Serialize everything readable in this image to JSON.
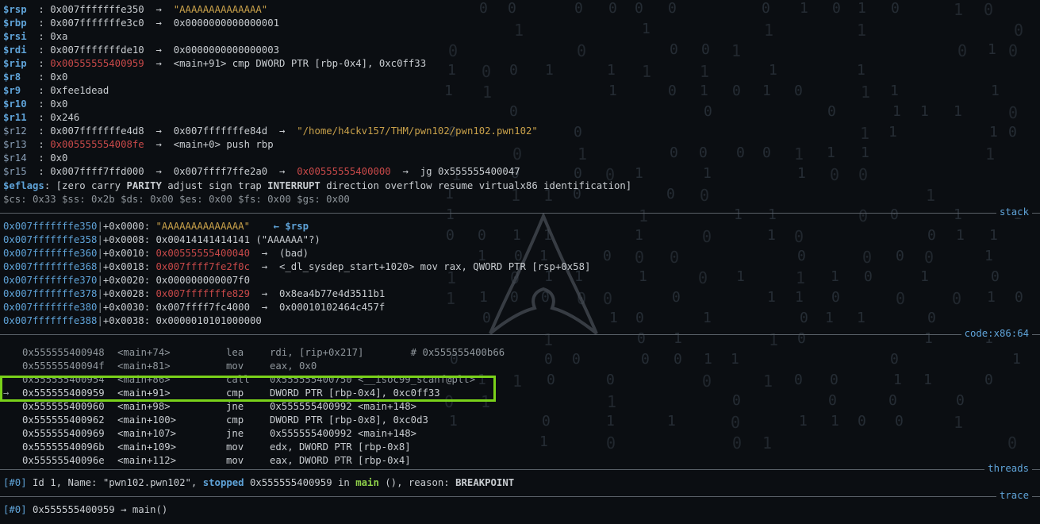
{
  "registers": [
    {
      "name": "$rsp",
      "style": "bold",
      "value": "0x007fffffffe350",
      "chain": [
        {
          "t": "→",
          "c": "arrow"
        },
        {
          "t": "\"AAAAAAAAAAAAAA\"",
          "c": "str"
        }
      ]
    },
    {
      "name": "$rbp",
      "style": "bold",
      "value": "0x007fffffffe3c0",
      "chain": [
        {
          "t": "→",
          "c": "arrow"
        },
        {
          "t": "0x0000000000000001",
          "c": "addr"
        }
      ]
    },
    {
      "name": "$rsi",
      "style": "bold",
      "value": "0xa",
      "chain": []
    },
    {
      "name": "$rdi",
      "style": "bold",
      "value": "0x007fffffffde10",
      "chain": [
        {
          "t": "→",
          "c": "arrow"
        },
        {
          "t": "0x0000000000000003",
          "c": "addr"
        }
      ]
    },
    {
      "name": "$rip",
      "style": "bold",
      "value": "0x00555555400959",
      "valueClass": "code-addr",
      "chain": [
        {
          "t": "→",
          "c": "arrow"
        },
        {
          "t": "<main+91> cmp DWORD PTR [rbp-0x4], 0xc0ff33",
          "c": "addr"
        }
      ]
    },
    {
      "name": "$r8",
      "style": "bold",
      "value": "0x0",
      "chain": []
    },
    {
      "name": "$r9",
      "style": "bold",
      "value": "0xfee1dead",
      "chain": []
    },
    {
      "name": "$r10",
      "style": "bold",
      "value": "0x0",
      "chain": []
    },
    {
      "name": "$r11",
      "style": "bold",
      "value": "0x246",
      "chain": []
    },
    {
      "name": "$r12",
      "style": "dim",
      "value": "0x007fffffffe4d8",
      "chain": [
        {
          "t": "→",
          "c": "arrow"
        },
        {
          "t": "0x007fffffffe84d",
          "c": "addr"
        },
        {
          "t": "→",
          "c": "arrow"
        },
        {
          "t": "\"/home/h4ckv157/THM/pwn102/pwn102.pwn102\"",
          "c": "str"
        }
      ]
    },
    {
      "name": "$r13",
      "style": "dim",
      "value": "0x005555554008fe",
      "valueClass": "code-addr",
      "chain": [
        {
          "t": "→",
          "c": "arrow"
        },
        {
          "t": "<main+0> push rbp",
          "c": "addr"
        }
      ]
    },
    {
      "name": "$r14",
      "style": "dim",
      "value": "0x0",
      "chain": []
    },
    {
      "name": "$r15",
      "style": "dim",
      "value": "0x007ffff7ffd000",
      "chain": [
        {
          "t": "→",
          "c": "arrow"
        },
        {
          "t": "0x007ffff7ffe2a0",
          "c": "addr"
        },
        {
          "t": "→",
          "c": "arrow"
        },
        {
          "t": "0x00555555400000",
          "c": "code-addr"
        },
        {
          "t": "→",
          "c": "arrow"
        },
        {
          "t": "jg 0x555555400047",
          "c": "addr"
        }
      ]
    }
  ],
  "eflags": {
    "label": "$eflags",
    "value": "[zero carry PARITY adjust sign trap INTERRUPT direction overflow resume virtualx86 identification]"
  },
  "segments": "$cs: 0x33 $ss: 0x2b $ds: 0x00 $es: 0x00 $fs: 0x00 $gs: 0x00",
  "sections": {
    "stack": "stack",
    "code": "code:x86:64",
    "threads": "threads",
    "trace": "trace"
  },
  "stack": [
    {
      "addr": "0x007fffffffe350",
      "off": "+0x0000:",
      "val": "\"AAAAAAAAAAAAAA\"",
      "valClass": "str",
      "rest": "    ← $rsp",
      "restClass": "blue bold"
    },
    {
      "addr": "0x007fffffffe358",
      "off": "+0x0008:",
      "val": "0x00414141414141 (\"AAAAAA\"?)",
      "valClass": "addr",
      "rest": "",
      "restClass": ""
    },
    {
      "addr": "0x007fffffffe360",
      "off": "+0x0010:",
      "val": "0x00555555400040",
      "valClass": "code-addr",
      "rest": "  →  (bad)",
      "restClass": "addr"
    },
    {
      "addr": "0x007fffffffe368",
      "off": "+0x0018:",
      "val": "0x007ffff7fe2f0c",
      "valClass": "code-addr",
      "rest": "  →  <_dl_sysdep_start+1020> mov rax, QWORD PTR [rsp+0x58]",
      "restClass": "addr"
    },
    {
      "addr": "0x007fffffffe370",
      "off": "+0x0020:",
      "val": "0x000000000007f0",
      "valClass": "addr",
      "rest": "",
      "restClass": ""
    },
    {
      "addr": "0x007fffffffe378",
      "off": "+0x0028:",
      "val": "0x007fffffffe829",
      "valClass": "code-addr",
      "rest": "  →  0x8ea4b77e4d3511b1",
      "restClass": "addr"
    },
    {
      "addr": "0x007fffffffe380",
      "off": "+0x0030:",
      "val": "0x007ffff7fc4000",
      "valClass": "addr",
      "rest": "  →  0x00010102464c457f",
      "restClass": "addr"
    },
    {
      "addr": "0x007fffffffe388",
      "off": "+0x0038:",
      "val": "0x0000010101000000",
      "valClass": "addr",
      "rest": "",
      "restClass": ""
    }
  ],
  "code": [
    {
      "mark": "",
      "addr": "0x555555400948",
      "sym": "<main+74>",
      "op": "lea",
      "args": "rdi, [rip+0x217]        # 0x555555400b66",
      "cls": "dim"
    },
    {
      "mark": "",
      "addr": "0x55555540094f",
      "sym": "<main+81>",
      "op": "mov",
      "args": "eax, 0x0",
      "cls": "dim"
    },
    {
      "mark": "",
      "addr": "0x555555400954",
      "sym": "<main+86>",
      "op": "call",
      "args": "0x555555400750 <__isoc99_scanf@plt>",
      "cls": "dim"
    },
    {
      "mark": "→",
      "addr": "0x555555400959",
      "sym": "<main+91>",
      "op": "cmp",
      "args": "DWORD PTR [rbp-0x4], 0xc0ff33",
      "cls": "cur"
    },
    {
      "mark": "",
      "addr": "0x555555400960",
      "sym": "<main+98>",
      "op": "jne",
      "args": "0x555555400992 <main+148>",
      "cls": "cur"
    },
    {
      "mark": "",
      "addr": "0x555555400962",
      "sym": "<main+100>",
      "op": "cmp",
      "args": "DWORD PTR [rbp-0x8], 0xc0d3",
      "cls": "cur"
    },
    {
      "mark": "",
      "addr": "0x555555400969",
      "sym": "<main+107>",
      "op": "jne",
      "args": "0x555555400992 <main+148>",
      "cls": "cur"
    },
    {
      "mark": "",
      "addr": "0x55555540096b",
      "sym": "<main+109>",
      "op": "mov",
      "args": "edx, DWORD PTR [rbp-0x8]",
      "cls": "cur"
    },
    {
      "mark": "",
      "addr": "0x55555540096e",
      "sym": "<main+112>",
      "op": "mov",
      "args": "eax, DWORD PTR [rbp-0x4]",
      "cls": "cur"
    }
  ],
  "thread": {
    "id": "[#0]",
    "text1": " Id 1, Name: \"pwn102.pwn102\", ",
    "state": "stopped",
    "text2": " 0x555555400959 in ",
    "func": "main",
    "text3": " (), reason: ",
    "reason": "BREAKPOINT"
  },
  "trace": {
    "id": "[#0]",
    "text": " 0x555555400959 → main()"
  },
  "colors": {
    "accent": "#5fa3d8",
    "code_addr": "#c94949",
    "string": "#c9a14a",
    "highlight_box": "#7ad11a",
    "background": "#0b0e12"
  }
}
